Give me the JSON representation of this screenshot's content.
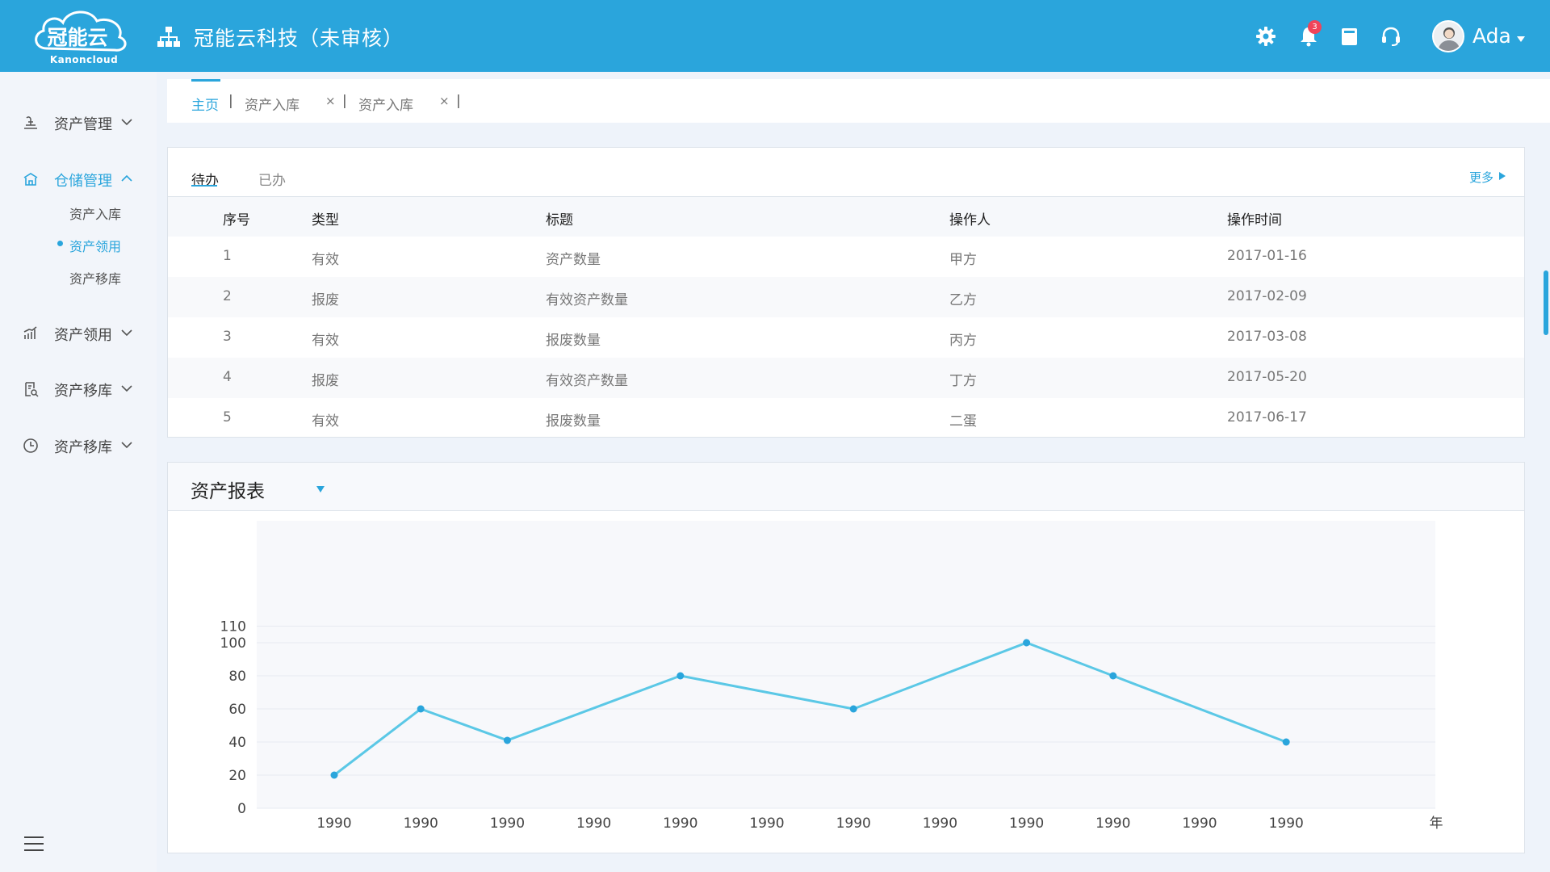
{
  "header": {
    "logo_text_cn": "冠能云",
    "logo_text_en": "Kanoncloud",
    "company": "冠能云科技（未审核）",
    "notification_count": "3",
    "user_name": "Ada",
    "icons": [
      "org-chart-icon",
      "settings-icon",
      "bell-icon",
      "book-icon",
      "headset-icon",
      "avatar",
      "caret-down-icon"
    ]
  },
  "sidebar": {
    "groups": [
      {
        "label": "资产管理",
        "icon": "asset-icon",
        "expanded": false
      },
      {
        "label": "仓储管理",
        "icon": "warehouse-icon",
        "expanded": true,
        "active": true,
        "children": [
          "资产入库",
          "资产领用",
          "资产移库"
        ],
        "active_child": "资产领用"
      },
      {
        "label": "资产领用",
        "icon": "bar-chart-icon",
        "expanded": false
      },
      {
        "label": "资产移库",
        "icon": "document-search-icon",
        "expanded": false
      },
      {
        "label": "资产移库",
        "icon": "clock-icon",
        "expanded": false
      }
    ]
  },
  "tabs": {
    "items": [
      {
        "label": "主页",
        "active": true,
        "closable": false
      },
      {
        "label": "资产入库",
        "active": false,
        "closable": true
      },
      {
        "label": "资产入库",
        "active": false,
        "closable": true
      }
    ],
    "separator": "|",
    "close_glyph": "×"
  },
  "tasks": {
    "subtabs": [
      {
        "label": "待办",
        "active": true
      },
      {
        "label": "已办",
        "active": false
      }
    ],
    "more_label": "更多",
    "columns": [
      "序号",
      "类型",
      "标题",
      "操作人",
      "操作时间"
    ],
    "rows": [
      [
        "1",
        "有效",
        "资产数量",
        "甲方",
        "2017-01-16"
      ],
      [
        "2",
        "报废",
        "有效资产数量",
        "乙方",
        "2017-02-09"
      ],
      [
        "3",
        "有效",
        "报废数量",
        "丙方",
        "2017-03-08"
      ],
      [
        "4",
        "报废",
        "有效资产数量",
        "丁方",
        "2017-05-20"
      ],
      [
        "5",
        "有效",
        "报废数量",
        "二蛋",
        "2017-06-17"
      ]
    ]
  },
  "report": {
    "title": "资产报表"
  },
  "chart_data": {
    "type": "line",
    "title": "",
    "xlabel": "年",
    "ylabel": "",
    "categories": [
      "1990",
      "1990",
      "1990",
      "1990",
      "1990",
      "1990",
      "1990",
      "1990",
      "1990",
      "1990",
      "1990",
      "1990"
    ],
    "yticks": [
      0,
      20,
      40,
      60,
      80,
      100,
      110
    ],
    "ylim": [
      0,
      110
    ],
    "grid": true,
    "series": [
      {
        "points": [
          {
            "x_index": 0,
            "y": 20
          },
          {
            "x_index": 1,
            "y": 60
          },
          {
            "x_index": 2,
            "y": 41
          },
          {
            "x_index": 4,
            "y": 80
          },
          {
            "x_index": 6,
            "y": 60
          },
          {
            "x_index": 8,
            "y": 100
          },
          {
            "x_index": 9,
            "y": 80
          },
          {
            "x_index": 11,
            "y": 40
          }
        ]
      }
    ],
    "colors": {
      "line": "#5bc8e6",
      "marker": "#2aa5dc"
    }
  },
  "colors": {
    "primary": "#2aa5dc",
    "badge": "#f0445a",
    "sidebar_bg": "#f2f5fa",
    "page_bg": "#eef3fa"
  }
}
